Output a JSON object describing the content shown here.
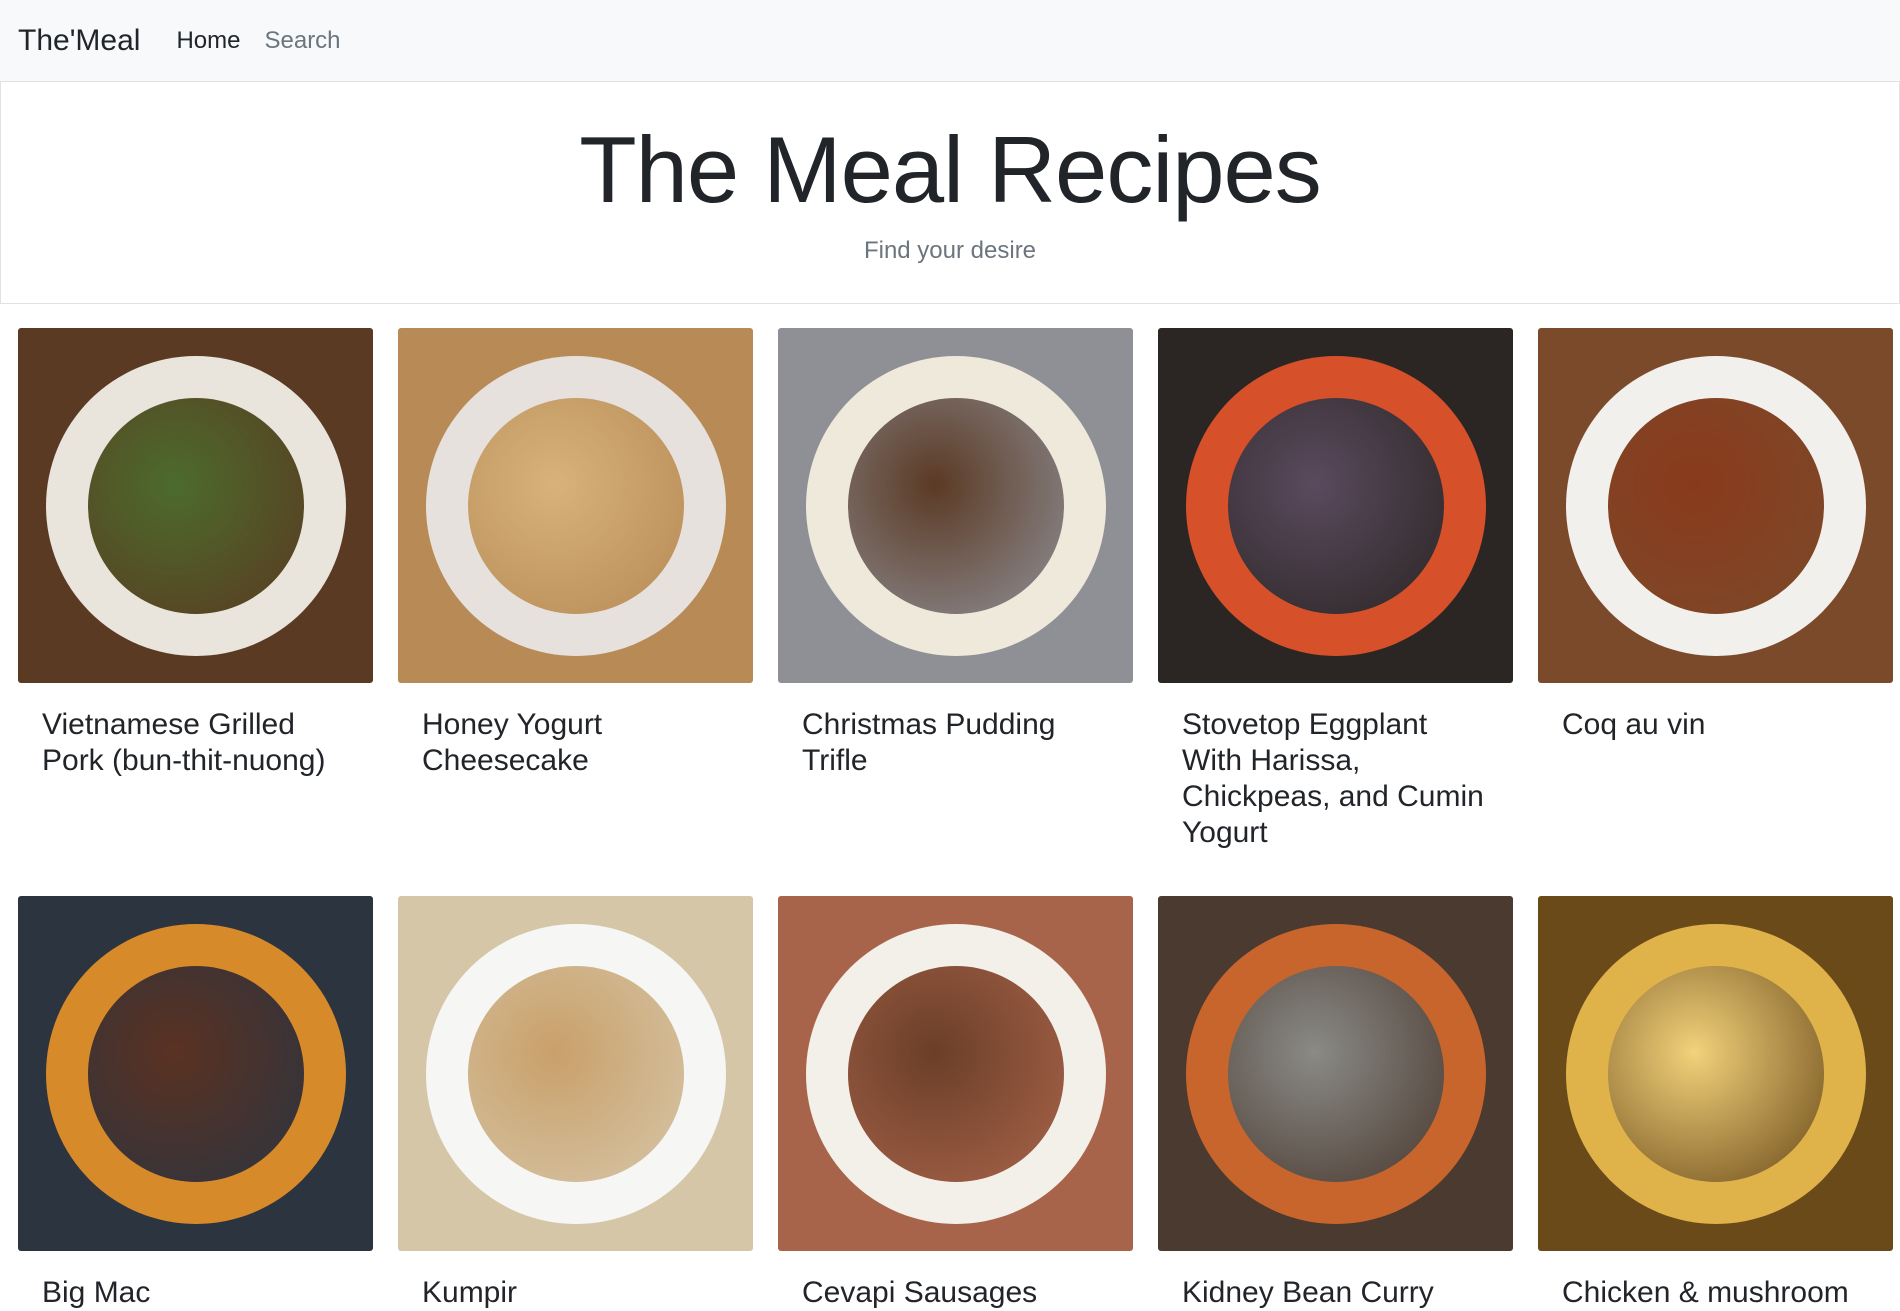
{
  "nav": {
    "brand": "The'Meal",
    "links": [
      {
        "label": "Home"
      },
      {
        "label": "Search"
      }
    ]
  },
  "hero": {
    "title": "The Meal Recipes",
    "subtitle": "Find your desire"
  },
  "recipes": [
    {
      "title": "Vietnamese Grilled Pork (bun-thit-nuong)",
      "image_icon": "noodle-bowl-photo",
      "colors": [
        "#5a3a22",
        "#e9e4dc",
        "#4c6b2c"
      ]
    },
    {
      "title": "Honey Yogurt Cheesecake",
      "image_icon": "cheesecake-photo",
      "colors": [
        "#b78a56",
        "#e6e1dc",
        "#d7b27a"
      ]
    },
    {
      "title": "Christmas Pudding Trifle",
      "image_icon": "trifle-photo",
      "colors": [
        "#8f8f96",
        "#efe9dc",
        "#5b3a24"
      ]
    },
    {
      "title": "Stovetop Eggplant With Harissa, Chickpeas, and Cumin Yogurt",
      "image_icon": "eggplant-skillet-photo",
      "colors": [
        "#2b2624",
        "#d6502a",
        "#5a4a5e"
      ]
    },
    {
      "title": "Coq au vin",
      "image_icon": "coq-au-vin-photo",
      "colors": [
        "#7b4a2a",
        "#f2f0ec",
        "#8a3a1c"
      ]
    },
    {
      "title": "Big Mac",
      "image_icon": "burger-photo",
      "colors": [
        "#2c3440",
        "#d78a2a",
        "#5a3222"
      ]
    },
    {
      "title": "Kumpir",
      "image_icon": "baked-potato-photo",
      "colors": [
        "#d6c6a8",
        "#f6f6f4",
        "#c9a06a"
      ]
    },
    {
      "title": "Cevapi Sausages",
      "image_icon": "sausages-photo",
      "colors": [
        "#a8644a",
        "#f3efe9",
        "#6b3e28"
      ]
    },
    {
      "title": "Kidney Bean Curry",
      "image_icon": "curry-pot-photo",
      "colors": [
        "#4a3a30",
        "#c8652c",
        "#8a8a86"
      ]
    },
    {
      "title": "Chicken & mushroom",
      "image_icon": "potato-bake-photo",
      "colors": [
        "#6b4a1a",
        "#e0b24a",
        "#f2d27a"
      ]
    }
  ]
}
